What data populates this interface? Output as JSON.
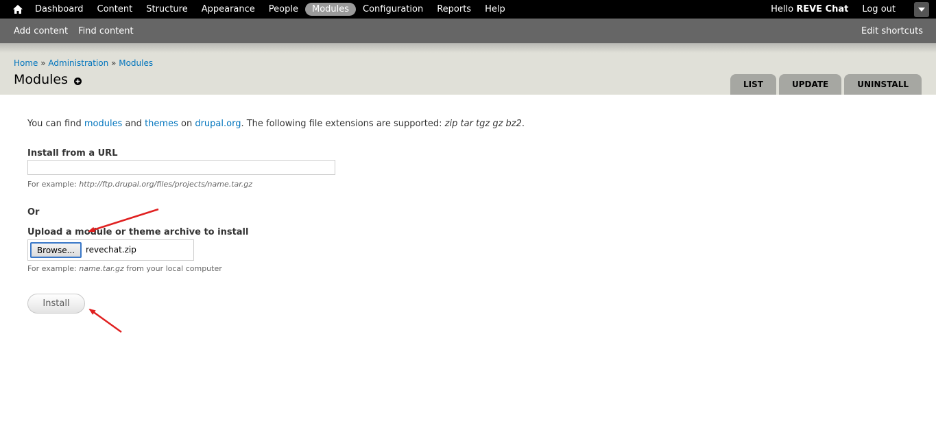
{
  "toolbar": {
    "menu": [
      "Dashboard",
      "Content",
      "Structure",
      "Appearance",
      "People",
      "Modules",
      "Configuration",
      "Reports",
      "Help"
    ],
    "active_index": 5,
    "greeting": "Hello ",
    "username": "REVE Chat",
    "logout": "Log out"
  },
  "shortcuts": {
    "links": [
      "Add content",
      "Find content"
    ],
    "edit": "Edit shortcuts"
  },
  "breadcrumb": {
    "items": [
      "Home",
      "Administration",
      "Modules"
    ],
    "separator": " » "
  },
  "page_title": "Modules",
  "tabs": [
    "LIST",
    "UPDATE",
    "UNINSTALL"
  ],
  "intro": {
    "part1": "You can find ",
    "link_modules": "modules",
    "part2": " and ",
    "link_themes": "themes",
    "part3": " on ",
    "link_drupal": "drupal.org",
    "part4": ". The following file extensions are supported: ",
    "extensions": "zip tar tgz gz bz2",
    "part5": "."
  },
  "url_field": {
    "label": "Install from a URL",
    "value": "",
    "desc_prefix": "For example: ",
    "desc_example": "http://ftp.drupal.org/files/projects/name.tar.gz"
  },
  "or_label": "Or",
  "upload_field": {
    "label": "Upload a module or theme archive to install",
    "browse": "Browse...",
    "file_name": "revechat.zip",
    "desc_prefix": "For example: ",
    "desc_example": "name.tar.gz",
    "desc_suffix": " from your local computer"
  },
  "install_button": "Install",
  "colors": {
    "link": "#0074bd",
    "toolbar": "#000000",
    "shortcuts": "#666666",
    "annotation_arrow": "#e02020"
  }
}
